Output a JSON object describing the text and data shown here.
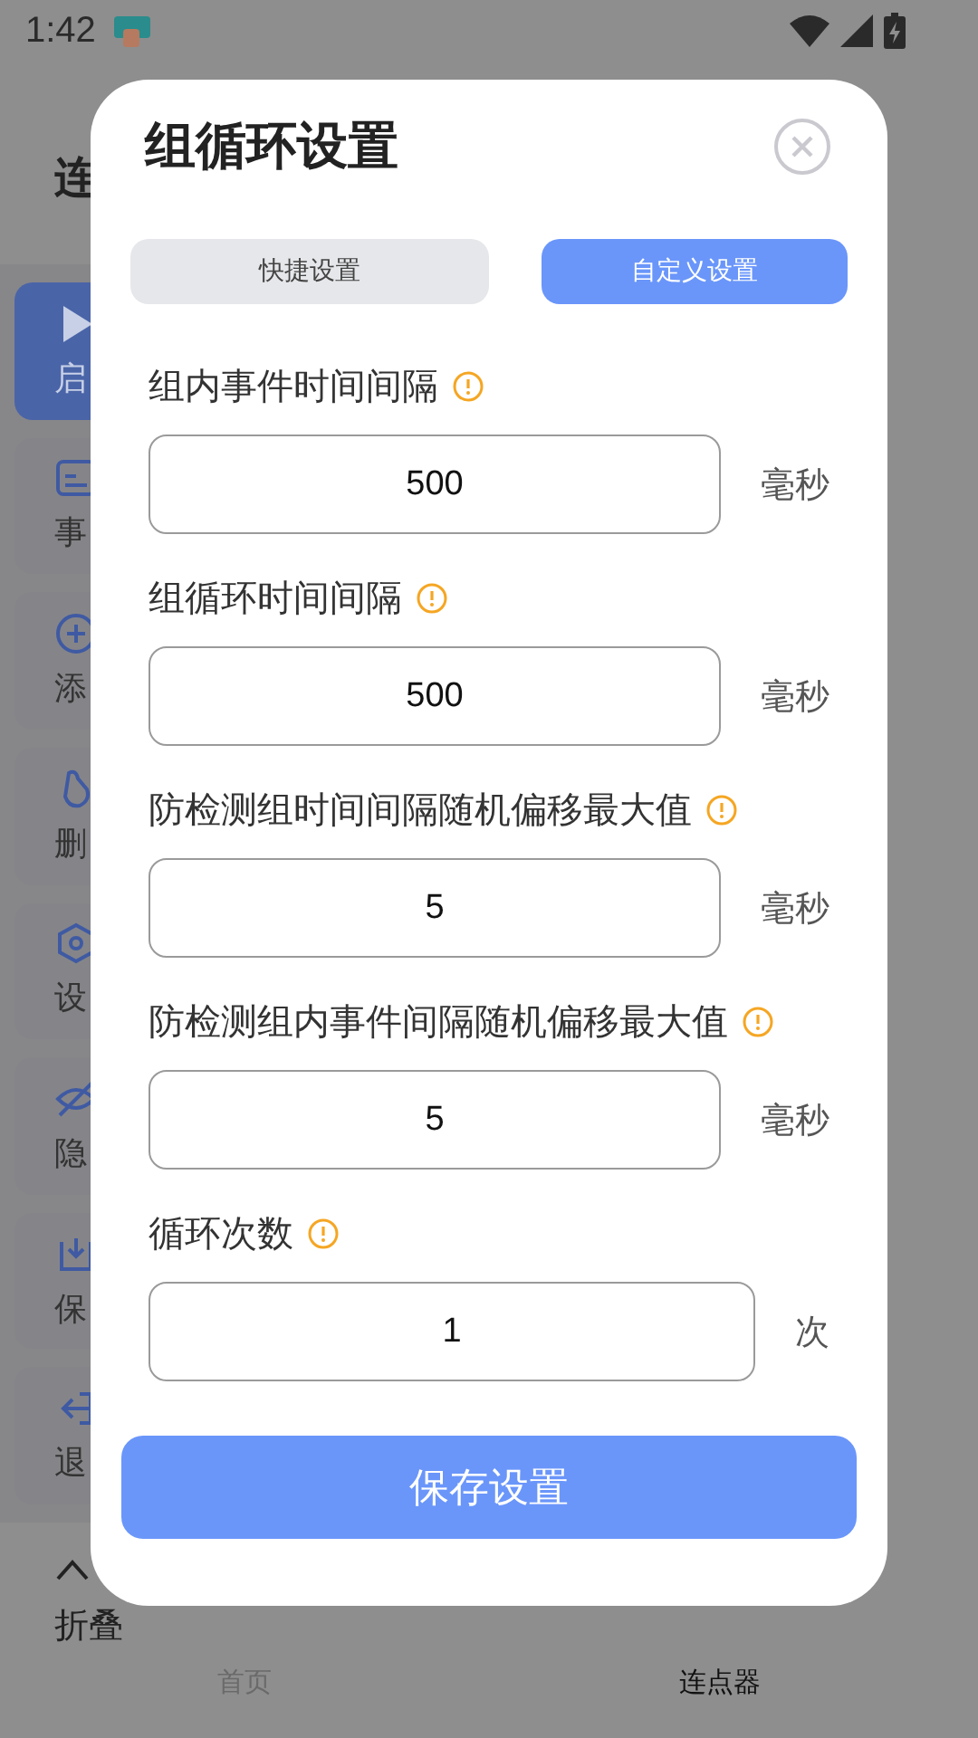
{
  "status_bar": {
    "time": "1:42"
  },
  "background": {
    "title": "连",
    "sidebar": [
      {
        "label": "启",
        "selected": true
      },
      {
        "label": "事",
        "selected": false
      },
      {
        "label": "添",
        "selected": false
      },
      {
        "label": "删",
        "selected": false
      },
      {
        "label": "设",
        "selected": false
      },
      {
        "label": "隐",
        "selected": false
      },
      {
        "label": "保",
        "selected": false
      },
      {
        "label": "退",
        "selected": false
      }
    ],
    "collapse": "折叠",
    "bottom_nav": [
      {
        "label": "首页",
        "selected": false
      },
      {
        "label": "连点器",
        "selected": true
      }
    ]
  },
  "dialog": {
    "title": "组循环设置",
    "tabs": [
      {
        "label": "快捷设置",
        "selected": false
      },
      {
        "label": "自定义设置",
        "selected": true
      }
    ],
    "fields": [
      {
        "label": "组内事件时间间隔",
        "value": "500",
        "unit": "毫秒"
      },
      {
        "label": "组循环时间间隔",
        "value": "500",
        "unit": "毫秒"
      },
      {
        "label": "防检测组时间间隔随机偏移最大值",
        "value": "5",
        "unit": "毫秒"
      },
      {
        "label": "防检测组内事件间隔随机偏移最大值",
        "value": "5",
        "unit": "毫秒"
      },
      {
        "label": "循环次数",
        "value": "1",
        "unit": "次"
      }
    ],
    "save_button": "保存设置"
  }
}
